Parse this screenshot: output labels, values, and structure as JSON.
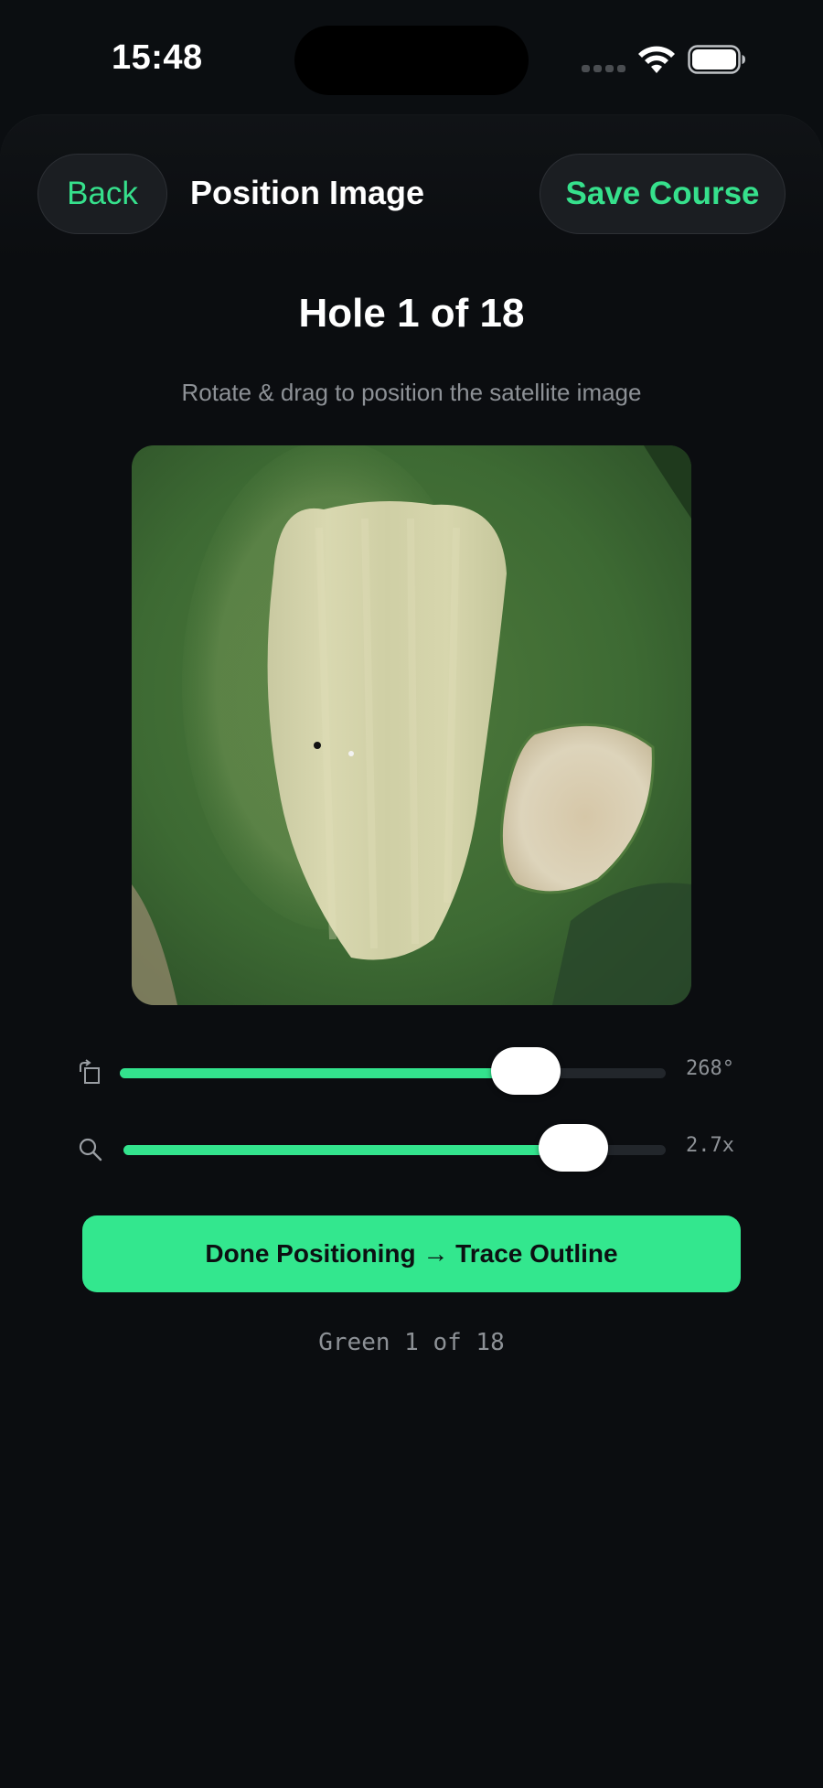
{
  "status_bar": {
    "time": "15:48"
  },
  "header": {
    "back_label": "Back",
    "title": "Position Image",
    "save_label": "Save Course"
  },
  "main": {
    "hole_title": "Hole 1 of 18",
    "instruction": "Rotate & drag to position the satellite image",
    "rotation": {
      "icon": "rotate-icon",
      "value": 268,
      "max": 360,
      "label": "268°"
    },
    "zoom": {
      "icon": "magnifier-icon",
      "value": 2.7,
      "fraction": 0.83,
      "label": "2.7x"
    },
    "primary_button_label": "Done Positioning → Trace Outline",
    "footer": "Green 1 of 18"
  },
  "colors": {
    "accent": "#33e38d",
    "background": "#0b0d10",
    "button_surface": "#1b1e22",
    "muted_text": "#8d9196"
  }
}
